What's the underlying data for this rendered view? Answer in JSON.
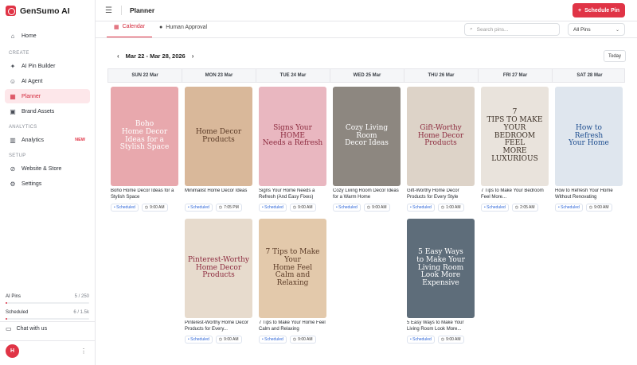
{
  "app": {
    "name": "GenSumo AI"
  },
  "sidebar": {
    "main_items": [
      {
        "label": "Home",
        "icon": "home-icon"
      }
    ],
    "sections": [
      {
        "title": "CREATE",
        "items": [
          {
            "label": "AI Pin Builder",
            "icon": "sparkle-icon"
          },
          {
            "label": "AI Agent",
            "icon": "robot-icon"
          },
          {
            "label": "Planner",
            "icon": "calendar-icon",
            "active": true
          },
          {
            "label": "Brand Assets",
            "icon": "image-icon"
          }
        ]
      },
      {
        "title": "ANALYTICS",
        "items": [
          {
            "label": "Analytics",
            "icon": "chart-icon",
            "badge": "NEW"
          }
        ]
      },
      {
        "title": "SETUP",
        "items": [
          {
            "label": "Website & Store",
            "icon": "link-icon"
          },
          {
            "label": "Settings",
            "icon": "gear-icon"
          }
        ]
      }
    ],
    "usage": {
      "ai_pins_label": "AI Pins",
      "ai_pins_value": "5 / 250",
      "ai_pins_fraction": 0.02,
      "scheduled_label": "Scheduled",
      "scheduled_value": "6 / 1.5k",
      "scheduled_fraction": 0.004
    },
    "chat_label": "Chat with us",
    "user_initial": "H"
  },
  "header": {
    "title": "Planner",
    "schedule_button": "Schedule Pin"
  },
  "tabs": [
    {
      "label": "Calendar",
      "active": true
    },
    {
      "label": "Human Approval"
    }
  ],
  "search": {
    "placeholder": "Search pins..."
  },
  "filter": {
    "value": "All Pins"
  },
  "range": {
    "label": "Mar 22 - Mar 28, 2026",
    "today": "Today"
  },
  "days": [
    "SUN 22 Mar",
    "MON 23 Mar",
    "TUE 24 Mar",
    "WED 25 Mar",
    "THU 26 Mar",
    "FRI 27 Mar",
    "SAT 28 Mar"
  ],
  "pins": [
    {
      "col": 0,
      "row": 0,
      "img": "Boho\nHome Decor\nIdeas for a\nStylish Space",
      "title": "Boho Home Decor Ideas for a Stylish Space",
      "status": "Scheduled",
      "time": "9:00 AM",
      "bg": "#e8a8ad",
      "fg": "#ffffff"
    },
    {
      "col": 1,
      "row": 0,
      "img": "Home Decor\nProducts",
      "title": "Minimalist Home Decor Ideas",
      "status": "Scheduled",
      "time": "7:05 PM",
      "bg": "#d9b89a",
      "fg": "#5a3a26"
    },
    {
      "col": 2,
      "row": 0,
      "img": "Signs Your\nHOME\nNeeds a Refresh",
      "title": "Signs Your Home Needs a Refresh (And Easy Fixes)",
      "status": "Scheduled",
      "time": "9:00 AM",
      "bg": "#e9b7c0",
      "fg": "#8c2a3e"
    },
    {
      "col": 3,
      "row": 0,
      "img": "Cozy Living Room\nDecor Ideas",
      "title": "Cozy Living Room Decor Ideas for a Warm Home",
      "status": "Scheduled",
      "time": "9:00 AM",
      "bg": "#8d8780",
      "fg": "#ffffff"
    },
    {
      "col": 4,
      "row": 0,
      "img": "Gift-Worthy\nHome Decor Products",
      "title": "Gift-Worthy Home Decor Products for Every Style",
      "status": "Scheduled",
      "time": "1:00 AM",
      "bg": "#ddd3c8",
      "fg": "#8c2a3e"
    },
    {
      "col": 5,
      "row": 0,
      "img": "7\nTIPS TO MAKE YOUR\nBEDROOM FEEL\nMORE LUXURIOUS",
      "title": "7 Tips to Make Your Bedroom Feel More...",
      "status": "Scheduled",
      "time": "2:05 AM",
      "bg": "#e9e3dc",
      "fg": "#3a2e24"
    },
    {
      "col": 6,
      "row": 0,
      "img": "How to\nRefresh\nYour Home",
      "title": "How to Refresh Your Home Without Renovating",
      "status": "Scheduled",
      "time": "9:00 AM",
      "bg": "#dfe6ee",
      "fg": "#1d4d8f"
    },
    {
      "col": 1,
      "row": 1,
      "img": "Pinterest-Worthy\nHome Decor Products",
      "title": "Pinterest-Worthy Home Decor Products for Every...",
      "status": "Scheduled",
      "time": "9:00 AM",
      "bg": "#e7dbcd",
      "fg": "#8c2a3e"
    },
    {
      "col": 2,
      "row": 1,
      "img": "7 Tips to Make Your\nHome Feel\nCalm and Relaxing",
      "title": "7 Tips to Make Your Home Feel Calm and Relaxing",
      "status": "Scheduled",
      "time": "9:00 AM",
      "bg": "#e3c9ab",
      "fg": "#5a3a26"
    },
    {
      "col": 4,
      "row": 1,
      "img": "5 Easy Ways\nto Make Your\nLiving Room\nLook More\nExpensive",
      "title": "5 Easy Ways to Make Your Living Room Look More...",
      "status": "Scheduled",
      "time": "9:00 AM",
      "bg": "#5e6d7a",
      "fg": "#ffffff"
    }
  ]
}
